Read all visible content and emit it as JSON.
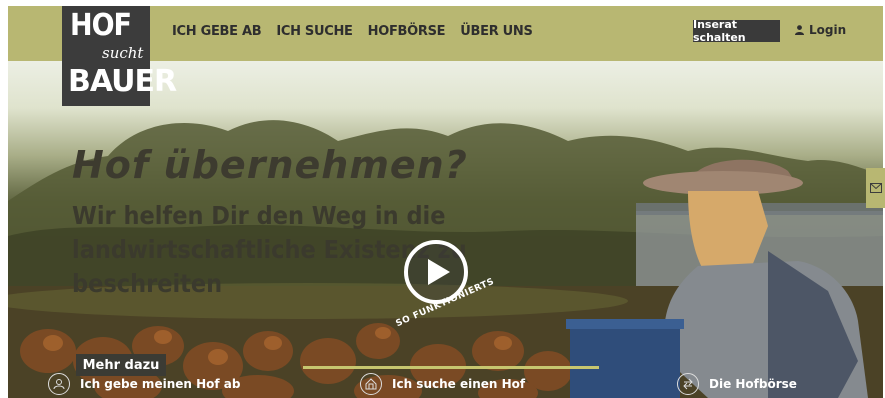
{
  "logo": {
    "line1": "HOF",
    "line2": "sucht",
    "line3": "BAUER"
  },
  "nav": {
    "items": [
      "ICH GEBE AB",
      "ICH SUCHE",
      "HOFBÖRSE",
      "ÜBER UNS"
    ]
  },
  "header": {
    "cta_label": "Inserat schalten",
    "login_label": "Login"
  },
  "hero": {
    "headline": "Hof übernehmen?",
    "subline": "Wir helfen Dir den Weg in die landwirtschaftliche Existenz zu beschreiten",
    "video_caption": "SO FUNKTIONIERTS",
    "more_label": "Mehr dazu"
  },
  "bottom_links": [
    {
      "label": "Ich gebe meinen Hof ab",
      "icon": "farmer-icon"
    },
    {
      "label": "Ich suche einen Hof",
      "icon": "barn-icon"
    },
    {
      "label": "Die Hofbörse",
      "icon": "exchange-icon"
    }
  ],
  "colors": {
    "accent": "#b8b772",
    "dark": "#3c3c3c",
    "highlight_line": "#c7c66f"
  }
}
